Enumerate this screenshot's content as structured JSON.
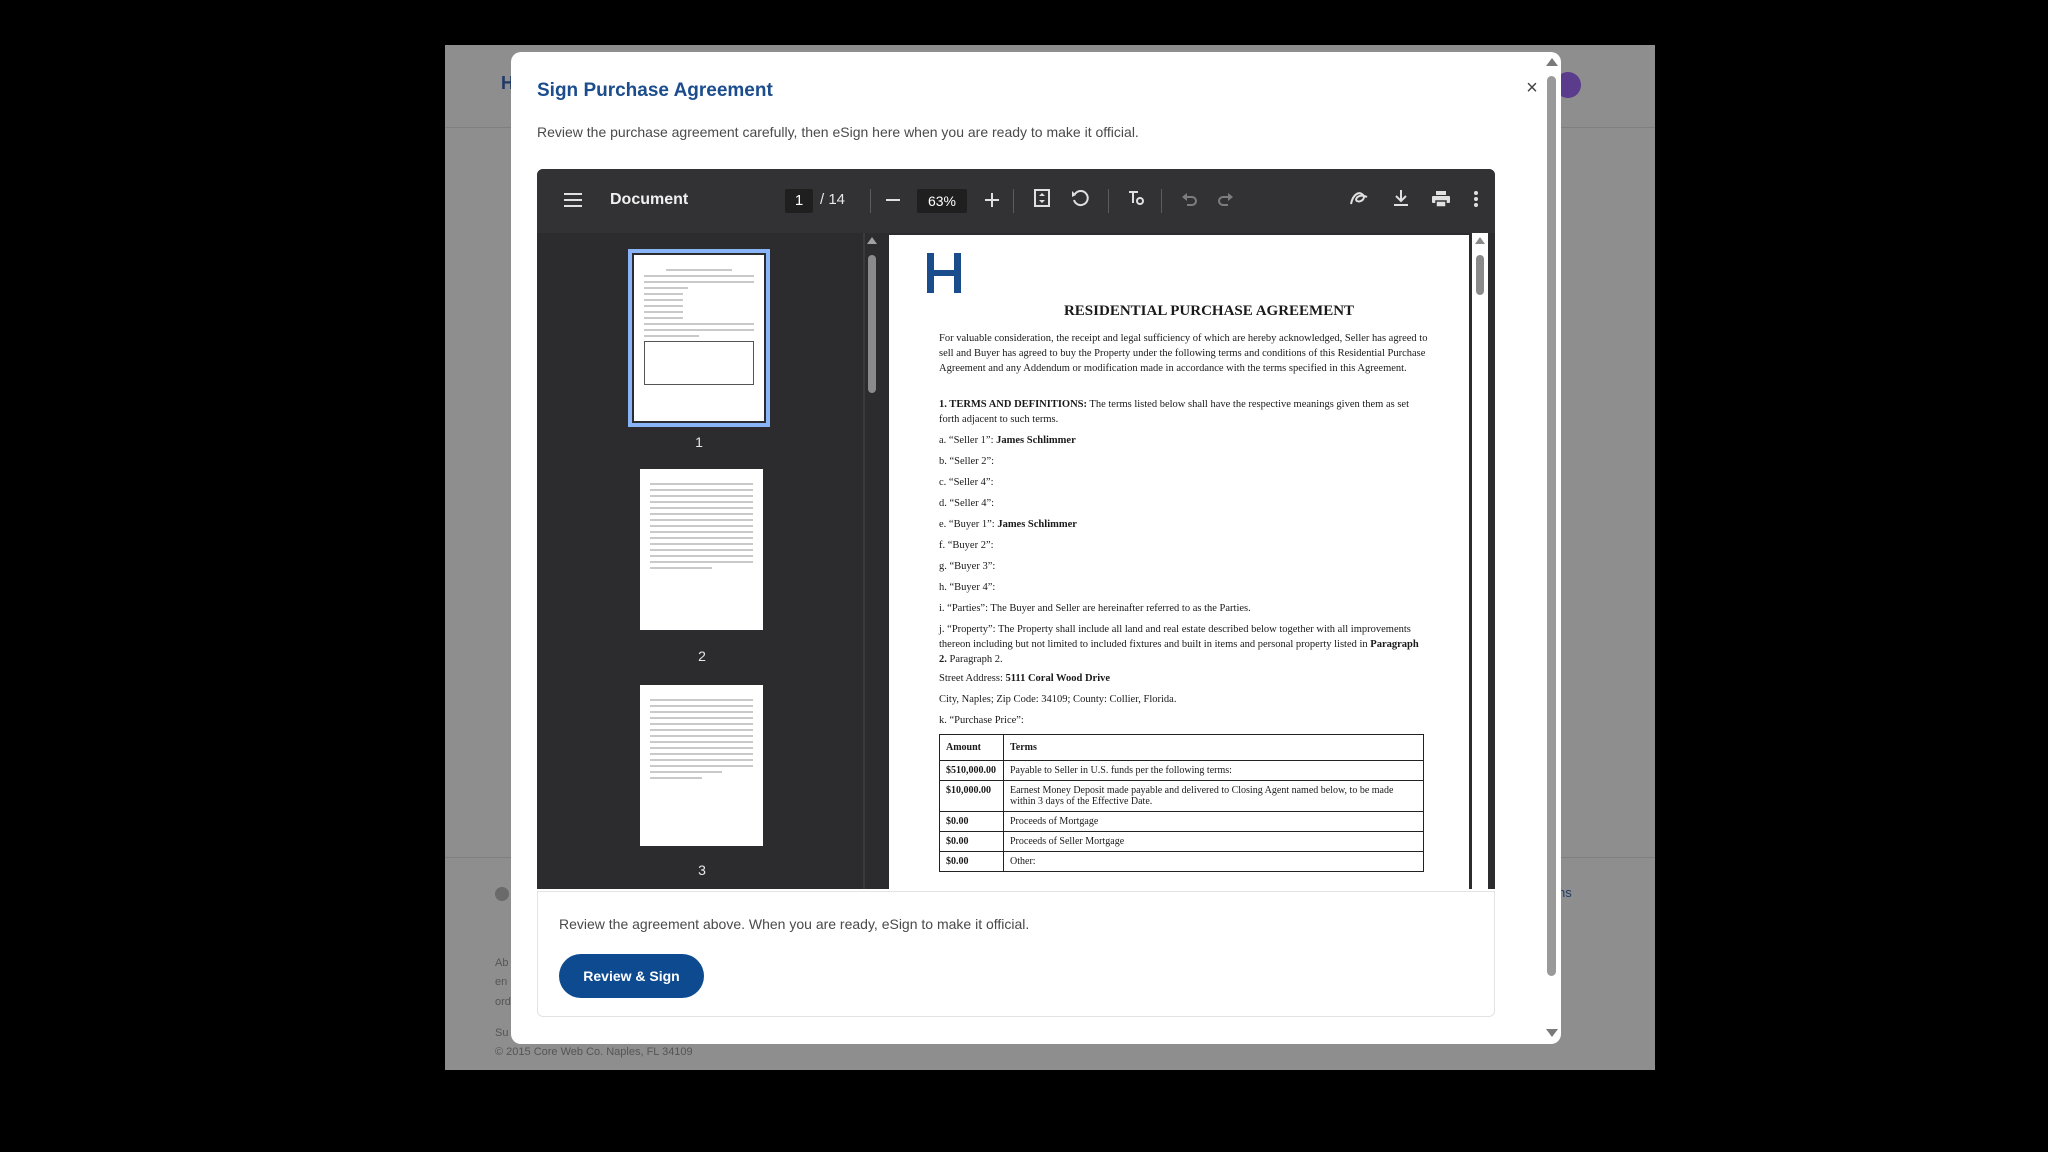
{
  "background": {
    "logo_text": "H",
    "footer_link": "ns",
    "footer_lines": [
      "Ab",
      "en",
      "ord",
      "Su"
    ],
    "copyright": "© 2015 Core Web Co. Naples, FL 34109"
  },
  "modal": {
    "title": "Sign Purchase Agreement",
    "close_label": "×",
    "description": "Review the purchase agreement carefully, then eSign here when you are ready to make it official."
  },
  "viewer": {
    "title": "Document",
    "current_page": "1",
    "page_total": "/ 14",
    "zoom": "63%",
    "icons": {
      "menu": "menu-icon",
      "zoom_out": "minus-icon",
      "zoom_in": "plus-icon",
      "fit": "fit-page-icon",
      "rotate": "rotate-icon",
      "annotate": "annotate-icon",
      "undo": "undo-icon",
      "redo": "redo-icon",
      "sign": "signature-icon",
      "download": "download-icon",
      "print": "print-icon",
      "more": "more-vertical-icon"
    },
    "thumbnails": [
      "1",
      "2",
      "3"
    ]
  },
  "document": {
    "heading": "RESIDENTIAL PURCHASE AGREEMENT",
    "intro": "For valuable consideration, the receipt and legal sufficiency of which are hereby acknowledged, Seller has agreed to sell and Buyer has agreed to buy the Property under the following terms and conditions of this Residential Purchase Agreement and any Addendum or modification made in accordance with the terms specified in this Agreement.",
    "terms_title": "1. TERMS AND DEFINITIONS:",
    "terms_body": " The terms listed below shall have the respective meanings given them as set forth adjacent to such terms.",
    "items": [
      {
        "label": "a. “Seller 1”: ",
        "value": "James Schlimmer"
      },
      {
        "label": "b. “Seller 2”:",
        "value": ""
      },
      {
        "label": "c. “Seller 4”:",
        "value": ""
      },
      {
        "label": "d. “Seller 4”:",
        "value": ""
      },
      {
        "label": "e. “Buyer 1”: ",
        "value": "James Schlimmer"
      },
      {
        "label": "f. “Buyer 2”:",
        "value": ""
      },
      {
        "label": "g. “Buyer 3”:",
        "value": ""
      },
      {
        "label": "h. “Buyer 4”:",
        "value": ""
      },
      {
        "label": "i. “Parties”: The Buyer and Seller are hereinafter referred to as the Parties.",
        "value": ""
      }
    ],
    "property_text_1": "j. “Property”: The Property shall include all land and real estate described below together with all improvements thereon including but not limited to included fixtures and built in items and personal property listed in ",
    "property_bold": "Paragraph 2.",
    "property_text_2": " Paragraph 2.",
    "street_label": "Street Address: ",
    "street_value": "5111 Coral Wood Drive",
    "city_line": "City, Naples; Zip Code: 34109; County: Collier, Florida.",
    "price_label": "k. “Purchase Price”:",
    "table": {
      "headers": [
        "Amount",
        "Terms"
      ],
      "rows": [
        [
          "$510,000.00",
          "Payable to Seller in U.S. funds per the following terms:"
        ],
        [
          "$10,000.00",
          "Earnest Money Deposit made payable and delivered to Closing Agent named below, to be made within 3 days of the Effective Date."
        ],
        [
          "$0.00",
          "Proceeds of Mortgage"
        ],
        [
          "$0.00",
          "Proceeds of Seller Mortgage"
        ],
        [
          "$0.00",
          "Other:"
        ]
      ]
    }
  },
  "sign_card": {
    "text": "Review the agreement above. When you are ready, eSign to make it official.",
    "button_label": "Review & Sign"
  },
  "colors": {
    "accent": "#0d4a8f",
    "title": "#1b4c8c",
    "toolbar": "#323234",
    "thumb_selected": "#8ab4f8"
  }
}
